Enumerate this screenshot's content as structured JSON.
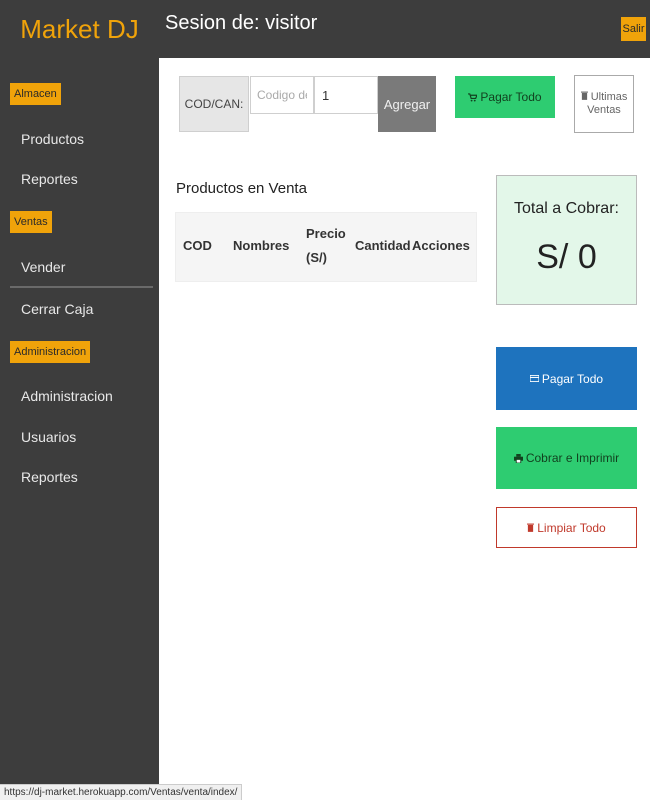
{
  "sidebar": {
    "brand": "Market DJ",
    "sections": [
      {
        "badge": "Almacen",
        "items": [
          "Productos",
          "Reportes"
        ]
      },
      {
        "badge": "Ventas",
        "items": [
          "Vender",
          "Cerrar Caja"
        ]
      },
      {
        "badge": "Administracion",
        "items": [
          "Administracion",
          "Usuarios",
          "Reportes"
        ]
      }
    ]
  },
  "header": {
    "session_title": "Sesion de: visitor",
    "logout_label": "Salir"
  },
  "entry": {
    "codcan_label": "COD/CAN:",
    "code_placeholder": "Codigo de t",
    "quantity_value": "1",
    "add_label": "Agregar"
  },
  "actions": {
    "pay_all_top_label": "Pagar Todo",
    "last_sales_line1": "Ultimas",
    "last_sales_line2": "Ventas"
  },
  "products": {
    "heading": "Productos en Venta",
    "columns": [
      "COD",
      "Nombres",
      "Precio",
      "(S/)",
      "Cantidad",
      "Acciones"
    ]
  },
  "total": {
    "label": "Total a Cobrar:",
    "value": "S/ 0"
  },
  "buttons": {
    "pay_all_label": "Pagar Todo",
    "charge_print_label": "Cobrar e Imprimir",
    "clear_all_label": "Limpiar Todo"
  },
  "status_bar": {
    "url": "https://dj-market.herokuapp.com/Ventas/venta/index/"
  },
  "colors": {
    "sidebar_bg": "#3d3d3d",
    "accent": "#f0a30a",
    "success": "#2ecc71",
    "primary": "#1e73be",
    "danger": "#c0392b",
    "total_bg": "#e3f7e9"
  },
  "icons": {
    "pay_top": "cart-icon",
    "last_sales": "trash-icon",
    "pay_all": "money-icon",
    "charge_print": "print-icon",
    "clear_all": "trash-icon"
  }
}
